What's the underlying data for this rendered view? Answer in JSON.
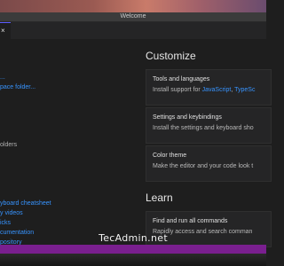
{
  "window": {
    "title": "Welcome"
  },
  "tab": {
    "close_icon": "×"
  },
  "left": {
    "start_links": [
      "...",
      "pace folder..."
    ],
    "recent_text": "olders",
    "help_links": [
      "yboard cheatsheet",
      "y videos",
      "icks",
      "cumentation",
      "pository"
    ]
  },
  "customize": {
    "heading": "Customize",
    "cards": [
      {
        "title": "Tools and languages",
        "desc_prefix": "Install support for ",
        "desc_link1": "JavaScript",
        "desc_sep": ", ",
        "desc_link2": "TypeSc"
      },
      {
        "title": "Settings and keybindings",
        "desc": "Install the settings and keyboard sho"
      },
      {
        "title": "Color theme",
        "desc": "Make the editor and your code look t"
      }
    ]
  },
  "learn": {
    "heading": "Learn",
    "cards": [
      {
        "title": "Find and run all commands",
        "desc": "Rapidly access and search comman"
      }
    ]
  },
  "watermark": "TecAdmin.net",
  "colors": {
    "link": "#3794ff",
    "statusbar": "#7a1f8f",
    "tab_accent": "#5b5bff"
  }
}
